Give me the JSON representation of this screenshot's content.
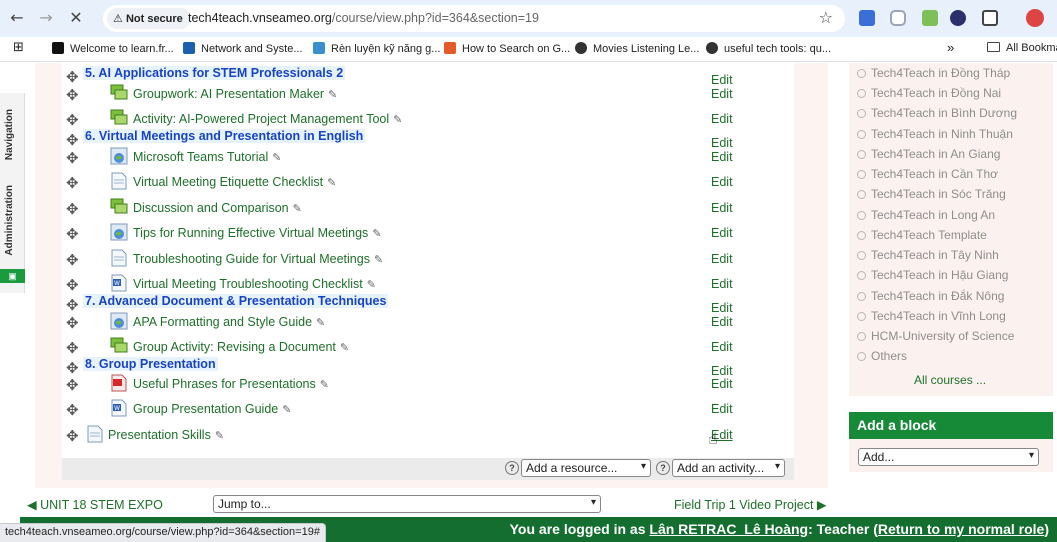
{
  "browser": {
    "security_label": "Not secure",
    "url_host": "tech4teach.vnseameo.org",
    "url_path": "/course/view.php?id=364&section=19",
    "bookmarks": [
      {
        "label": "Welcome to learn.fr...",
        "color": "#111111"
      },
      {
        "label": "Network and Syste...",
        "color": "#1b5fb0"
      },
      {
        "label": "Rèn luyện kỹ năng g...",
        "color": "#3a8fd0"
      },
      {
        "label": "How to Search on G...",
        "color": "#e55a2b"
      },
      {
        "label": "Movies Listening Le...",
        "color": "#333333"
      },
      {
        "label": "useful tech tools: qu...",
        "color": "#333333"
      }
    ],
    "bookmarks_overflow": "»",
    "all_bookmarks": "All Bookmarks",
    "status_url": "tech4teach.vnseameo.org/course/view.php?id=364&section=19#"
  },
  "sidebar_tabs": {
    "navigation": "Navigation",
    "administration": "Administration"
  },
  "sections": [
    {
      "title": "5. AI Applications for STEM Professionals 2",
      "activities": [
        {
          "name": "Groupwork: AI Presentation Maker",
          "icon": "forum-icon"
        },
        {
          "name": "Activity: AI-Powered Project Management Tool",
          "icon": "forum-icon"
        }
      ]
    },
    {
      "title": "6. Virtual Meetings and Presentation in English",
      "activities": [
        {
          "name": "Microsoft Teams Tutorial",
          "icon": "url-icon"
        },
        {
          "name": "Virtual Meeting Etiquette Checklist",
          "icon": "page-icon"
        },
        {
          "name": "Discussion and Comparison",
          "icon": "forum-icon"
        },
        {
          "name": "Tips for Running Effective Virtual Meetings",
          "icon": "url-icon"
        },
        {
          "name": "Troubleshooting Guide for Virtual Meetings",
          "icon": "page-icon"
        },
        {
          "name": "Virtual Meeting Troubleshooting Checklist",
          "icon": "word-icon"
        }
      ]
    },
    {
      "title": "7. Advanced Document & Presentation Techniques",
      "activities": [
        {
          "name": "APA Formatting and Style Guide",
          "icon": "url-icon"
        },
        {
          "name": "Group Activity: Revising a Document",
          "icon": "forum-icon"
        }
      ]
    },
    {
      "title": "8. Group Presentation",
      "activities": [
        {
          "name": "Useful Phrases for Presentations",
          "icon": "pdf-icon"
        },
        {
          "name": "Group Presentation Guide",
          "icon": "word-icon"
        }
      ]
    }
  ],
  "trailing_activity": {
    "name": "Presentation Skills",
    "icon": "page-icon"
  },
  "edit_label": "Edit",
  "add_resource": "Add a resource...",
  "add_activity": "Add an activity...",
  "categories": [
    "Tech4Teach in Đồng Tháp",
    "Tech4Teach in Đồng Nai",
    "Tech4Teach in Bình Dương",
    "Tech4Teach in Ninh Thuận",
    "Tech4Teach in An Giang",
    "Tech4Teach in Cần Thơ",
    "Tech4Teach in Sóc Trăng",
    "Tech4Teach in Long An",
    "Tech4Teach Template",
    "Tech4Teach in Tây Ninh",
    "Tech4Teach in Hậu Giang",
    "Tech4Teach in Đắk Nông",
    "Tech4Teach in Vĩnh Long",
    "HCM-University of Science",
    "Others"
  ],
  "all_courses": "All courses ...",
  "add_block": {
    "title": "Add a block",
    "select": "Add..."
  },
  "footer_nav": {
    "prev": "◀ UNIT 18 STEM EXPO",
    "jump_to": "Jump to...",
    "next": "Field Trip 1 Video Project ▶"
  },
  "login": {
    "prefix": "You are logged in as ",
    "user": "Lân RETRAC_Lê Hoàng",
    "role": ": Teacher (",
    "return_link": "Return to my normal role",
    "suffix": ")"
  },
  "colors": {
    "brand_green": "#178a38",
    "link_green": "#1f6f2b",
    "section_blue": "#1844c4"
  }
}
